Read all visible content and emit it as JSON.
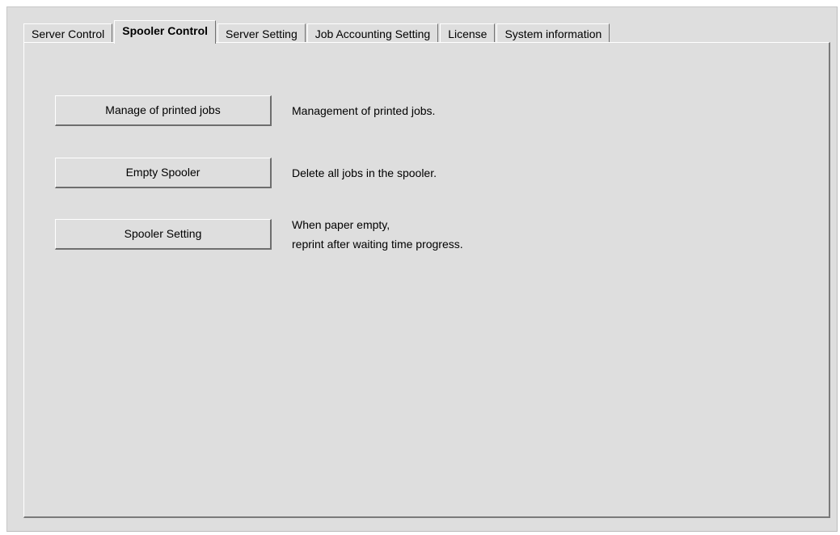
{
  "tabs": [
    {
      "label": "Server Control",
      "selected": false
    },
    {
      "label": "Spooler Control",
      "selected": true
    },
    {
      "label": "Server Setting",
      "selected": false
    },
    {
      "label": "Job Accounting Setting",
      "selected": false
    },
    {
      "label": "License",
      "selected": false
    },
    {
      "label": "System information",
      "selected": false
    }
  ],
  "actions": [
    {
      "button_label": "Manage of printed jobs",
      "description_lines": [
        "Management of printed jobs."
      ]
    },
    {
      "button_label": "Empty Spooler",
      "description_lines": [
        "Delete all jobs in the spooler."
      ]
    },
    {
      "button_label": "Spooler Setting",
      "description_lines": [
        "When paper empty,",
        "reprint after waiting time progress."
      ]
    }
  ]
}
